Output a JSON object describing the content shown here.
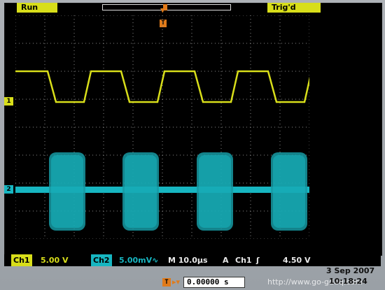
{
  "status": {
    "run_label": "Run",
    "trigger_state": "Trig'd"
  },
  "markers": {
    "ch1": "1",
    "ch2": "2",
    "trigger": "T"
  },
  "readout": {
    "ch1_label": "Ch1",
    "ch1_scale": "5.00 V",
    "ch2_label": "Ch2",
    "ch2_scale": "5.00mV∿",
    "timebase": "M 10.0μs",
    "trigger_mode": "A",
    "trigger_source": "Ch1",
    "trigger_slope": "ʃ",
    "trigger_level": "4.50 V"
  },
  "bottom": {
    "trigger_time_icon": "T",
    "trigger_time_arrow": "▸▾",
    "trigger_time": "0.00000 s",
    "date": "3 Sep  2007",
    "time": "10:18:24",
    "watermark": "http://www.go-gddq.com"
  },
  "colors": {
    "ch1": "#d8de1a",
    "ch2": "#17b6c1",
    "trigger": "#e07b1b",
    "grid": "#8a8a8a"
  }
}
